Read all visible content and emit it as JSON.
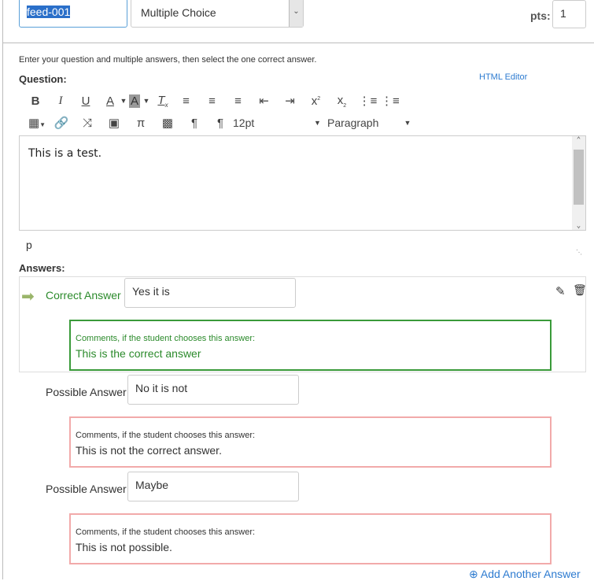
{
  "header": {
    "question_name": "feed-001",
    "question_type": "Multiple Choice",
    "points_label": "pts:",
    "points_value": "1"
  },
  "instructions": "Enter your question and multiple answers, then select the one correct answer.",
  "question": {
    "label": "Question:",
    "html_editor_link": "HTML Editor",
    "font_size": "12pt",
    "block_format": "Paragraph",
    "content": "This is a test.",
    "path": "p"
  },
  "toolbar": {
    "row1": [
      "bold-icon",
      "italic-icon",
      "underline-icon",
      "text-color-icon",
      "background-color-icon",
      "clear-formatting-icon",
      "align-left-icon",
      "align-center-icon",
      "align-right-icon",
      "outdent-icon",
      "indent-icon",
      "superscript-icon",
      "subscript-icon",
      "bullet-list-icon",
      "numbered-list-icon"
    ],
    "row2": [
      "table-icon",
      "link-icon",
      "unlink-icon",
      "image-icon",
      "math-icon",
      "media-icon",
      "ltr-icon",
      "rtl-icon"
    ]
  },
  "answers": {
    "label": "Answers:",
    "comment_label": "Comments, if the student chooses this answer:",
    "items": [
      {
        "kind": "Correct Answer",
        "value": "Yes it is",
        "comment": "This is the correct answer"
      },
      {
        "kind": "Possible Answer",
        "value": "No it is not",
        "comment": "This is not the correct answer."
      },
      {
        "kind": "Possible Answer",
        "value": "Maybe",
        "comment": "This is not possible."
      }
    ],
    "add_link": "Add Another Answer"
  },
  "colors": {
    "correct": "#2b8a2b",
    "incorrect_border": "#f2aaaa",
    "link": "#2d7bd0"
  }
}
